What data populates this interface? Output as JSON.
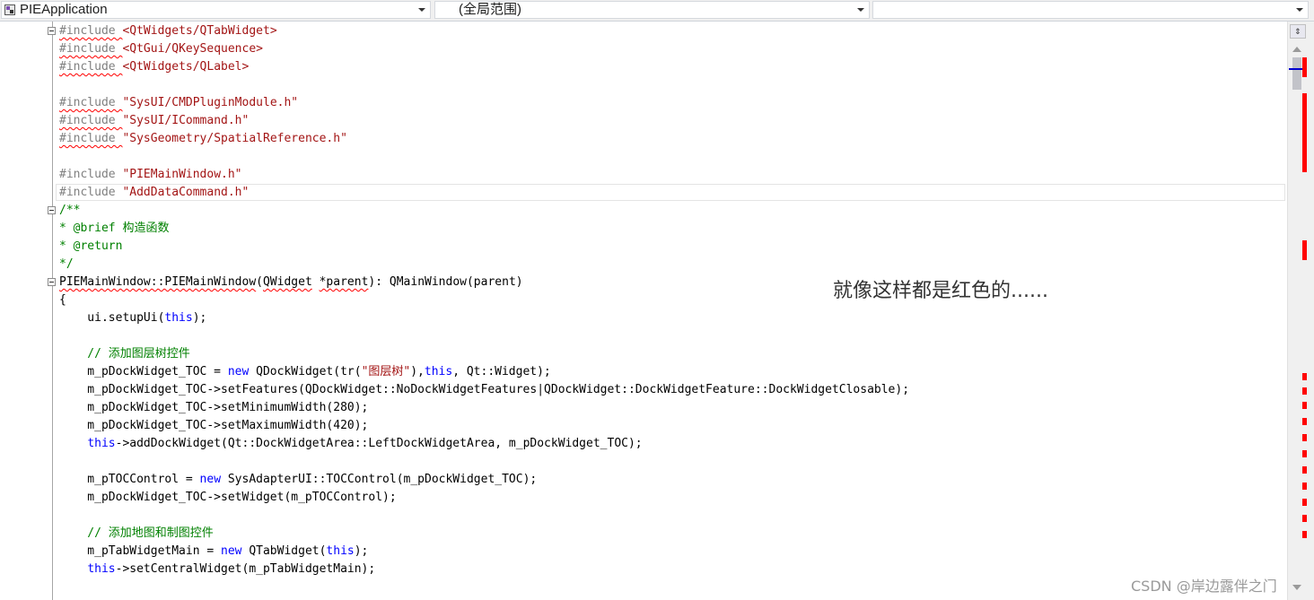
{
  "navbar": {
    "project": "PIEApplication",
    "scope": "(全局范围)",
    "member": ""
  },
  "code_lines": [
    "#include <QtWidgets/QTabWidget>",
    "#include <QtGui/QKeySequence>",
    "#include <QtWidgets/QLabel>",
    "",
    "#include \"SysUI/CMDPluginModule.h\"",
    "#include \"SysUI/ICommand.h\"",
    "#include \"SysGeometry/SpatialReference.h\"",
    "",
    "#include \"PIEMainWindow.h\"",
    "#include \"AddDataCommand.h\"",
    "/**",
    "* @brief 构造函数",
    "* @return",
    "*/",
    "PIEMainWindow::PIEMainWindow(QWidget *parent): QMainWindow(parent)",
    "{",
    "    ui.setupUi(this);",
    "",
    "    // 添加图层树控件",
    "    m_pDockWidget_TOC = new QDockWidget(tr(\"图层树\"),this, Qt::Widget);",
    "    m_pDockWidget_TOC->setFeatures(QDockWidget::NoDockWidgetFeatures|QDockWidget::DockWidgetFeature::DockWidgetClosable);",
    "    m_pDockWidget_TOC->setMinimumWidth(280);",
    "    m_pDockWidget_TOC->setMaximumWidth(420);",
    "    this->addDockWidget(Qt::DockWidgetArea::LeftDockWidgetArea, m_pDockWidget_TOC);",
    "",
    "    m_pTOCControl = new SysAdapterUI::TOCControl(m_pDockWidget_TOC);",
    "    m_pDockWidget_TOC->setWidget(m_pTOCControl);",
    "",
    "    // 添加地图和制图控件",
    "    m_pTabWidgetMain = new QTabWidget(this);",
    "    this->setCentralWidget(m_pTabWidgetMain);"
  ],
  "annotation": "就像这样都是红色的......",
  "watermark": "CSDN @岸边露伴之门",
  "colors": {
    "keyword": "#0000ff",
    "preprocessor": "#808080",
    "string": "#a31515",
    "comment": "#008000",
    "error": "#ff0000"
  },
  "icons": [
    "project-icon",
    "split-editor-icon",
    "scroll-up-icon",
    "scroll-down-icon"
  ]
}
